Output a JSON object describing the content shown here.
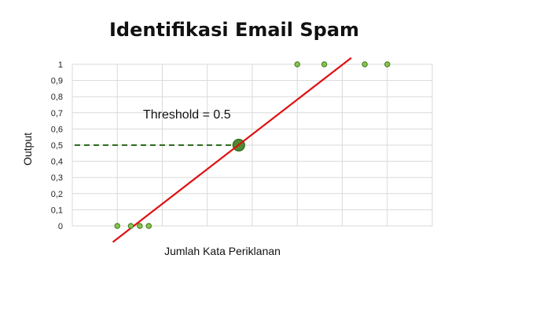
{
  "chart_data": {
    "type": "scatter",
    "title": "Identifikasi Email Spam",
    "xlabel": "Jumlah Kata Periklanan",
    "ylabel": "Output",
    "ylim": [
      0,
      1
    ],
    "xlim": [
      0,
      8
    ],
    "y_ticks": [
      "0",
      "0,1",
      "0,2",
      "0,3",
      "0,4",
      "0,5",
      "0,6",
      "0,7",
      "0,8",
      "0,9",
      "1"
    ],
    "grid": true,
    "points": [
      {
        "x": 1.0,
        "y": 0
      },
      {
        "x": 1.3,
        "y": 0
      },
      {
        "x": 1.5,
        "y": 0
      },
      {
        "x": 1.7,
        "y": 0
      },
      {
        "x": 5.0,
        "y": 1
      },
      {
        "x": 5.6,
        "y": 1
      },
      {
        "x": 6.5,
        "y": 1
      },
      {
        "x": 7.0,
        "y": 1
      }
    ],
    "regression_line": {
      "x": [
        0.9,
        6.2
      ],
      "y": [
        -0.1,
        1.04
      ]
    },
    "threshold": {
      "value": 0.5,
      "x": 3.7,
      "label": "Threshold = 0.5"
    },
    "colors": {
      "points": "#8bc34a",
      "point_stroke": "#3b7a1e",
      "line": "#e01010",
      "threshold": "#2e6b1f",
      "grid": "#d9d9d9"
    }
  }
}
